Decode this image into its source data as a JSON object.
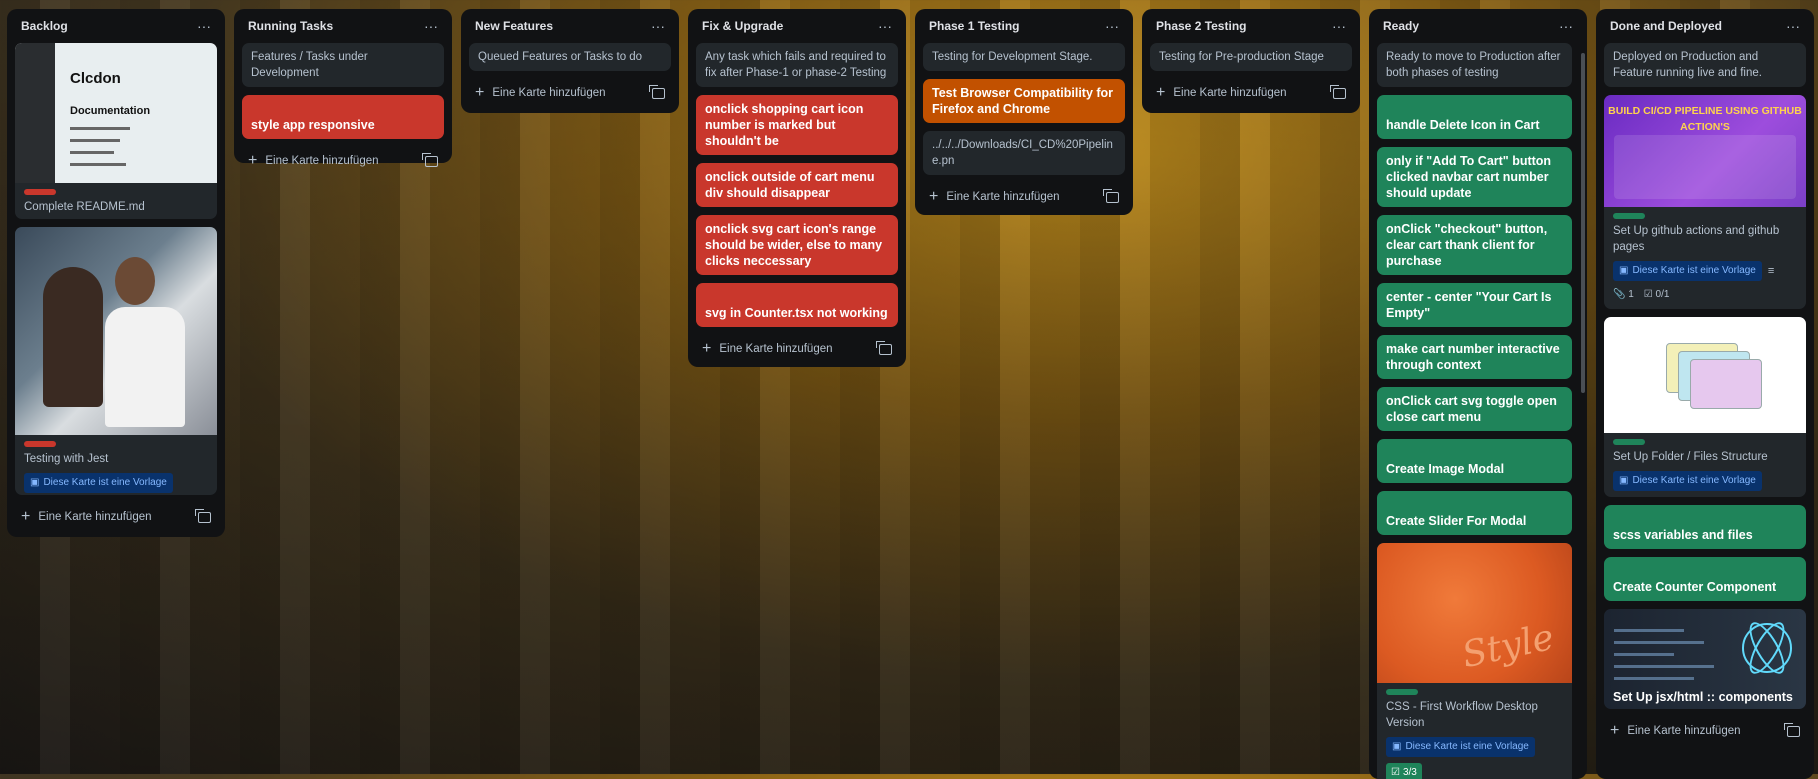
{
  "lists": [
    {
      "title": "Backlog",
      "cards": [
        {
          "title": "Complete README.md",
          "image_text_1": "Clcdon",
          "image_text_2": "Documentation"
        },
        {
          "title": "Testing with Jest",
          "badge": "Diese Karte ist eine Vorlage"
        }
      ],
      "add_label": "Eine Karte hinzufügen"
    },
    {
      "title": "Running Tasks",
      "description": "Features / Tasks under Development",
      "cards": [
        {
          "title": "style app responsive"
        }
      ],
      "add_label": "Eine Karte hinzufügen"
    },
    {
      "title": "New Features",
      "description": "Queued Features or Tasks to do",
      "add_label": "Eine Karte hinzufügen"
    },
    {
      "title": "Fix & Upgrade",
      "description": "Any task which fails and required to fix after Phase-1 or phase-2 Testing",
      "cards": [
        {
          "title": "onclick shopping cart icon number is marked but shouldn't be"
        },
        {
          "title": "onclick outside of cart menu div should disappear"
        },
        {
          "title": "onclick svg cart icon's range should be wider, else to many clicks neccessary"
        },
        {
          "title": "svg in Counter.tsx not working"
        }
      ],
      "add_label": "Eine Karte hinzufügen"
    },
    {
      "title": "Phase 1 Testing",
      "description": "Testing for Development Stage.",
      "cards": [
        {
          "title": "Test Browser Compatibility for Firefox and Chrome"
        },
        {
          "title": "../../../Downloads/CI_CD%20Pipeline.pn"
        }
      ],
      "add_label": "Eine Karte hinzufügen"
    },
    {
      "title": "Phase 2 Testing",
      "description": "Testing for Pre-production Stage",
      "add_label": "Eine Karte hinzufügen"
    },
    {
      "title": "Ready",
      "description": "Ready to move to Production after both phases of testing",
      "cards": [
        {
          "title": "handle Delete Icon in Cart"
        },
        {
          "title": "only if \"Add To Cart\" button clicked navbar cart number should update"
        },
        {
          "title": "onClick \"checkout\" button, clear cart thank client for purchase"
        },
        {
          "title": "center - center \"Your Cart Is Empty\""
        },
        {
          "title": "make cart number interactive through context"
        },
        {
          "title": "onClick cart svg toggle open close cart menu"
        },
        {
          "title": "Create Image Modal"
        },
        {
          "title": "Create Slider For Modal"
        },
        {
          "title": "CSS - First Workflow Desktop Version",
          "badge": "Diese Karte ist eine Vorlage",
          "checklist": "3/3",
          "image_text": "Style"
        }
      ]
    },
    {
      "title": "Done and Deployed",
      "description": "Deployed on Production and Feature running live and fine.",
      "cards": [
        {
          "title": "Set Up github actions and github pages",
          "badge": "Diese Karte ist eine Vorlage",
          "attachments": "1",
          "checklist": "0/1",
          "image_text": "BUILD CI/CD PIPELINE USING GITHUB ACTION'S"
        },
        {
          "title": "Set Up Folder / Files Structure",
          "badge": "Diese Karte ist eine Vorlage"
        },
        {
          "title": "scss variables and files"
        },
        {
          "title": "Create Counter Component"
        },
        {
          "title": "Set Up jsx/html :: components"
        }
      ],
      "add_label": "Eine Karte hinzufügen"
    }
  ],
  "menu_glyph": "···",
  "colors": {
    "red": "#c9372c",
    "green": "#1f845a",
    "orange": "#c25100",
    "list_bg": "#111214"
  }
}
